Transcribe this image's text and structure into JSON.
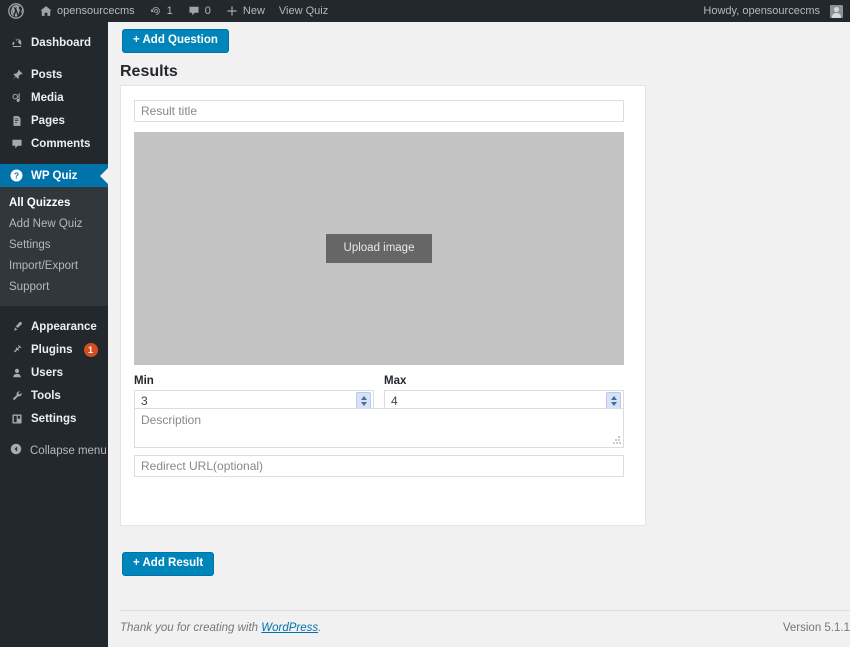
{
  "adminbar": {
    "wp_logo_icon": "wordpress-logo-icon",
    "site_icon": "home-icon",
    "site_name": "opensourcecms",
    "updates_icon": "updates-icon",
    "updates_count": "1",
    "comments_icon": "comment-bubble-icon",
    "comments_count": "0",
    "new_icon": "plus-icon",
    "new_label": "New",
    "view_quiz_label": "View Quiz",
    "howdy": "Howdy, opensourcecms",
    "avatar_icon": "user-avatar-icon"
  },
  "sidebar": {
    "items": [
      {
        "label": "Dashboard",
        "icon": "dashboard-icon"
      },
      {
        "label": "Posts",
        "icon": "pin-icon"
      },
      {
        "label": "Media",
        "icon": "media-icon"
      },
      {
        "label": "Pages",
        "icon": "page-icon"
      },
      {
        "label": "Comments",
        "icon": "comment-icon"
      },
      {
        "label": "WP Quiz",
        "icon": "question-mark-icon",
        "active": true
      },
      {
        "label": "Appearance",
        "icon": "paintbrush-icon"
      },
      {
        "label": "Plugins",
        "icon": "plug-icon",
        "badge": "1"
      },
      {
        "label": "Users",
        "icon": "users-icon"
      },
      {
        "label": "Tools",
        "icon": "wrench-icon"
      },
      {
        "label": "Settings",
        "icon": "settings-icon"
      }
    ],
    "submenu": [
      {
        "label": "All Quizzes",
        "current": true
      },
      {
        "label": "Add New Quiz"
      },
      {
        "label": "Settings"
      },
      {
        "label": "Import/Export"
      },
      {
        "label": "Support"
      }
    ],
    "collapse_label": "Collapse menu",
    "collapse_icon": "collapse-arrow-icon"
  },
  "main": {
    "add_question_label": "+ Add Question",
    "results_heading": "Results",
    "add_result_label": "+ Add Result",
    "result": {
      "title_placeholder": "Result title",
      "title_value": "",
      "upload_image_label": "Upload image",
      "min_label": "Min",
      "min_value": "3",
      "max_label": "Max",
      "max_value": "4",
      "description_placeholder": "Description",
      "description_value": "",
      "redirect_placeholder": "Redirect URL(optional)",
      "redirect_value": ""
    }
  },
  "footer": {
    "thanks_prefix": "Thank you for creating with ",
    "wordpress_link": "WordPress",
    "thanks_suffix": ".",
    "version": "Version 5.1.1"
  },
  "colors": {
    "admin_dark": "#23282d",
    "submenu_dark": "#32373c",
    "accent_blue": "#0073aa",
    "button_blue": "#0085ba",
    "badge_orange": "#d54e21",
    "placeholder_gray": "#c4c4c4",
    "upload_btn_gray": "#666666"
  }
}
